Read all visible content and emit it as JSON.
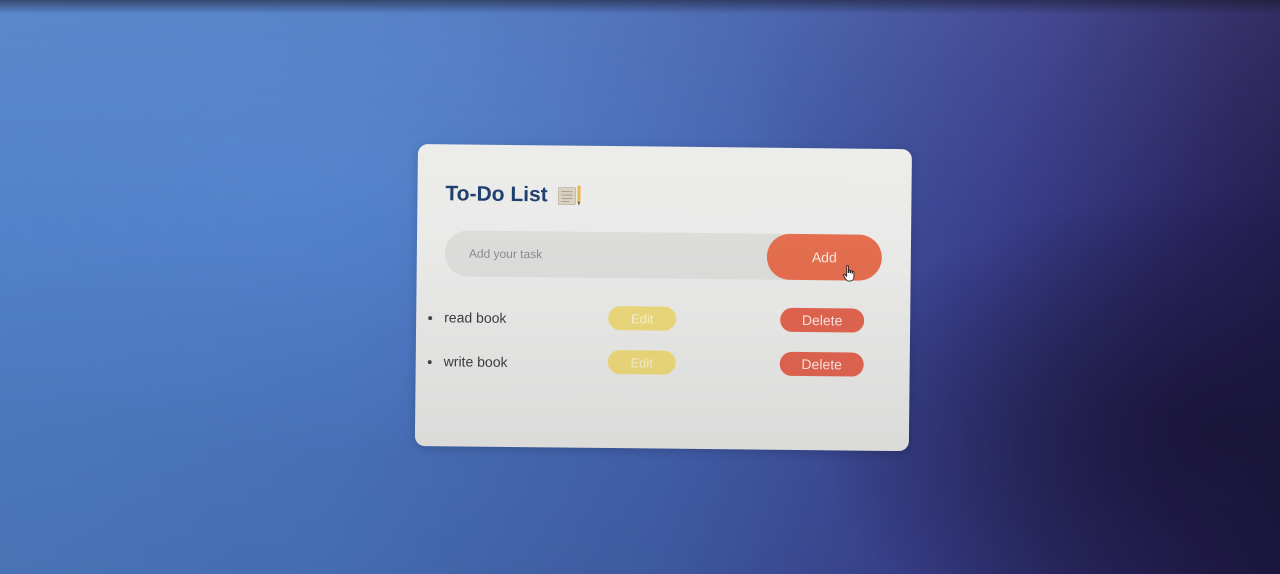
{
  "app": {
    "title": "To-Do List",
    "title_icon": "notepad-icon"
  },
  "input": {
    "placeholder": "Add your task",
    "value": ""
  },
  "add_button": {
    "label": "Add"
  },
  "cursor": {
    "icon": "hand-pointer-icon"
  },
  "tasks": [
    {
      "text": "read book",
      "edit_label": "Edit",
      "delete_label": "Delete"
    },
    {
      "text": "write book",
      "edit_label": "Edit",
      "delete_label": "Delete"
    }
  ],
  "colors": {
    "title": "#1f3f6e",
    "add_button": "#e46e4f",
    "edit_button": "#ecd87a",
    "delete_button": "#e06450",
    "card": "#ececeb",
    "input_bg": "#dcdcdb"
  }
}
